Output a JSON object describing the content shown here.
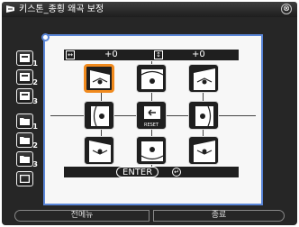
{
  "window": {
    "title": "키스톤_종횡 왜곡 보정",
    "close_label": "⊗"
  },
  "side_buttons": [
    {
      "name": "memory-1",
      "num": "1"
    },
    {
      "name": "memory-2",
      "num": "2"
    },
    {
      "name": "memory-3",
      "num": "3"
    },
    {
      "name": "folder-1",
      "num": "1"
    },
    {
      "name": "folder-2",
      "num": "2"
    },
    {
      "name": "folder-3",
      "num": "3"
    },
    {
      "name": "screen",
      "num": ""
    }
  ],
  "value_bar": {
    "h_icon": "↔",
    "h_value": "+0",
    "v_icon": "↕",
    "v_value": "+0"
  },
  "grid": {
    "reset_label": "RESET",
    "selected": "top-left"
  },
  "enter_bar": {
    "label": "ENTER",
    "suffix": ", "
  },
  "bottom": {
    "left_label": "전메뉴",
    "right_label": "종료"
  },
  "colors": {
    "accent_border": "#5a86d8",
    "selected_border": "#f08a1e",
    "background": "#262626"
  }
}
